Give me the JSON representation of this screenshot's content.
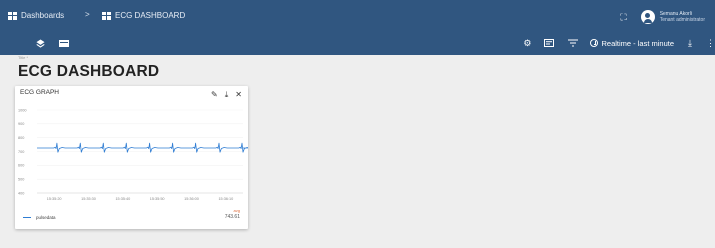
{
  "header": {
    "breadcrumb_root": "Dashboards",
    "breadcrumb_separator": ">",
    "breadcrumb_current": "ECG DASHBOARD",
    "user_name": "Semanu Akorli",
    "user_role": "Tenant administrator",
    "timewindow_label": "Realtime - last minute"
  },
  "page": {
    "title_label": "Title *",
    "title": "ECG DASHBOARD"
  },
  "widget": {
    "title": "ECG GRAPH",
    "legend_label": "pulsedata",
    "avg_label": "avg",
    "avg_value": "743.61"
  },
  "colors": {
    "header_bg": "#305680",
    "series": "#2f7dd3"
  },
  "chart_data": {
    "type": "line",
    "ylim": [
      400,
      1000
    ],
    "yticks": [
      1000,
      900,
      800,
      700,
      600,
      500,
      400
    ],
    "xticks": [
      "15:35:20",
      "15:35:30",
      "15:35:40",
      "15:35:50",
      "15:36:00",
      "15:36:10"
    ],
    "series": [
      {
        "name": "pulsedata",
        "beat_times_s": [
          20.8,
          27.6,
          34.3,
          41,
          47.8,
          54.5,
          61.2,
          68,
          74.7
        ],
        "baseline": 725,
        "peak": 760,
        "trough": 695
      }
    ]
  }
}
